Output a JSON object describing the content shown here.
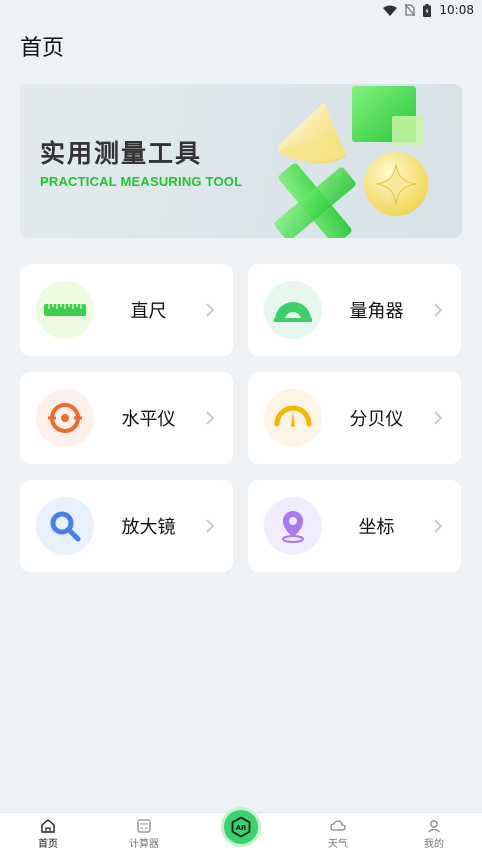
{
  "status_bar": {
    "time": "10:08"
  },
  "page": {
    "title": "首页"
  },
  "banner": {
    "title": "实用测量工具",
    "subtitle": "PRACTICAL MEASURING TOOL"
  },
  "tools": [
    {
      "label": "直尺",
      "icon": "ruler-icon",
      "color": "#3ccf4e"
    },
    {
      "label": "量角器",
      "icon": "protractor-icon",
      "color": "#3ccf6a"
    },
    {
      "label": "水平仪",
      "icon": "level-icon",
      "color": "#f06a2a"
    },
    {
      "label": "分贝仪",
      "icon": "decibel-meter-icon",
      "color": "#f5b800"
    },
    {
      "label": "放大镜",
      "icon": "magnifier-icon",
      "color": "#4a7ef0"
    },
    {
      "label": "坐标",
      "icon": "location-pin-icon",
      "color": "#a879f0"
    }
  ],
  "tabbar": {
    "items": [
      {
        "label": "首页",
        "icon": "home-icon",
        "active": true
      },
      {
        "label": "计算器",
        "icon": "calculator-icon",
        "active": false
      },
      {
        "label": "天气",
        "icon": "cloud-icon",
        "active": false
      },
      {
        "label": "我的",
        "icon": "user-icon",
        "active": false
      }
    ],
    "center_button": {
      "label": "AR",
      "icon": "ar-icon",
      "color": "#36d46c"
    }
  }
}
